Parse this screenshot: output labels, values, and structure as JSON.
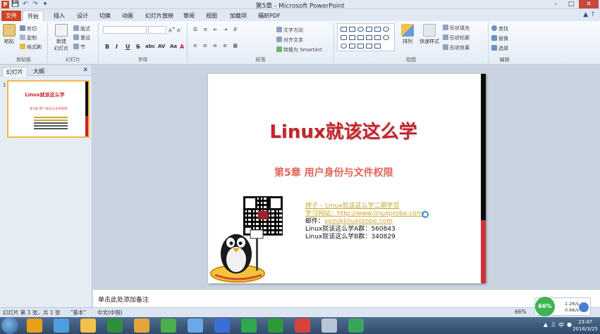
{
  "window": {
    "title": "第5章 - Microsoft PowerPoint",
    "app_icon": "P"
  },
  "tabs": [
    "文件",
    "开始",
    "插入",
    "设计",
    "切换",
    "动画",
    "幻灯片放映",
    "审阅",
    "视图",
    "加载项",
    "福昕PDF"
  ],
  "ribbon": {
    "clipboard": {
      "paste": "粘贴",
      "cut": "剪切",
      "copy": "复制",
      "painter": "格式刷",
      "label": "剪贴板"
    },
    "slides": {
      "new": "新建",
      "new2": "幻灯片",
      "layout": "版式",
      "reset": "重设",
      "section": "节",
      "label": "幻灯片"
    },
    "font": {
      "label": "字体",
      "bold": "B",
      "italic": "I",
      "underline": "U",
      "strike": "S",
      "shadow": "abc",
      "spacing": "AV",
      "case": "Aa",
      "color": "A"
    },
    "paragraph": {
      "text_dir": "文字方向",
      "align_text": "对齐文本",
      "smartart": "转换为 SmartArt",
      "label": "段落"
    },
    "drawing": {
      "arrange": "排列",
      "quick_styles": "快速样式",
      "fill": "形状填充",
      "outline": "形状轮廓",
      "effects": "形状效果",
      "label": "绘图"
    },
    "editing": {
      "find": "查找",
      "replace": "替换",
      "select": "选择",
      "label": "编辑"
    }
  },
  "panel": {
    "tab_slides": "幻灯片",
    "tab_outline": "大纲",
    "slide_number": "1",
    "thumb_title": "Linux就该这么学",
    "thumb_sub": "第5章 用户身份与文件权限"
  },
  "slide": {
    "title": "Linux就该这么学",
    "subtitle": "第5章 用户身份与文件权限",
    "author": "烨子 – Linux就该这么学二期学员",
    "site": "学习网站：http://www.linuxprobe.com/",
    "mail_label": "邮件：",
    "mail": "yezi@linuxprobe.com",
    "group_a": "Linux就该这么学A群：560843",
    "group_b": "Linux就该这么学B群：340829"
  },
  "notes": {
    "placeholder": "单击此处添加备注"
  },
  "status": {
    "slide_info": "幻灯片 第 1 张，共 1 张",
    "theme": "\"基本\"",
    "language": "中文(中国)",
    "zoom": "66%"
  },
  "network": {
    "percent": "66%",
    "up": "1.2K/s",
    "down": "0.6K/s"
  },
  "taskbar": {
    "time": "23:47",
    "date": "2016/3/25",
    "ime": "中",
    "colors": [
      "#e8a01a",
      "#4f9fe0",
      "#f3c14b",
      "#2f8f3a",
      "#e4a43a",
      "#4cae4c",
      "#6aa8e8",
      "#3a6fd8",
      "#2fa84f",
      "#2d9a3a",
      "#d8423a",
      "#b7c5d6",
      "#3aa55c"
    ]
  },
  "colors": {
    "accent_red": "#c8222a",
    "file_tab": "#d04423",
    "selection": "#f2b84b"
  }
}
